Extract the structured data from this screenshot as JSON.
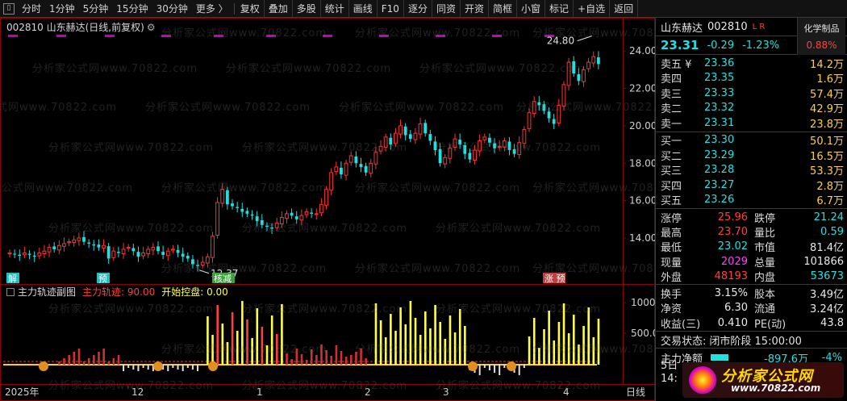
{
  "toolbar": {
    "periods": [
      "分时",
      "1分钟",
      "5分钟",
      "15分钟",
      "30分钟",
      "更多 〉"
    ],
    "buttons": [
      "复权",
      "叠加",
      "多股",
      "统计",
      "画线",
      "F10",
      "逐分",
      "同资",
      "开资",
      "简框",
      "小窗",
      "标记",
      "+自选",
      "返回"
    ]
  },
  "chart": {
    "title": "002810 山东赫达(日线,前复权)",
    "high_label": "24.80",
    "low_label": "12.37",
    "y_ticks": [
      "24.00",
      "22.00",
      "20.00",
      "18.00",
      "16.00",
      "14.00"
    ],
    "x_labels": [
      "2025年",
      "12",
      "1",
      "2",
      "3",
      "4",
      "日线"
    ],
    "event_tags": [
      {
        "text": "解",
        "color": "#20c0c0"
      },
      {
        "text": "预",
        "color": "#20c0c0"
      },
      {
        "text": "核减",
        "color": "#40a040"
      },
      {
        "text": "涨 预",
        "color": "#c04040"
      }
    ],
    "sub_title": {
      "name": "主力轨迹副图",
      "k1": "主力轨迹: 90.00",
      "k2": "开始控盘: 0.00"
    },
    "sub_y_ticks": [
      "1000",
      "500.0"
    ],
    "watermark": "分析家公式网www.70822.com"
  },
  "chart_data": {
    "type": "candlestick",
    "title": "002810 山东赫达(日线,前复权)",
    "y_range": [
      11.8,
      25.0
    ],
    "x_range_labels": [
      "2025年",
      "12",
      "1",
      "2",
      "3",
      "4"
    ],
    "high_marker": 24.8,
    "low_marker": 12.37,
    "closes": [
      13.2,
      13.15,
      13.05,
      13.2,
      13.1,
      13.0,
      13.2,
      13.3,
      13.5,
      13.4,
      13.6,
      13.7,
      13.8,
      13.9,
      14.0,
      13.8,
      13.7,
      13.6,
      13.5,
      13.6,
      12.9,
      13.3,
      13.2,
      13.4,
      13.5,
      13.3,
      13.0,
      13.2,
      13.4,
      13.5,
      13.3,
      13.1,
      13.3,
      13.4,
      13.2,
      13.0,
      12.9,
      12.6,
      12.5,
      12.7,
      13.0,
      14.1,
      15.9,
      16.6,
      15.8,
      15.7,
      15.6,
      15.4,
      15.3,
      15.2,
      14.9,
      14.7,
      14.6,
      14.5,
      14.8,
      15.1,
      15.3,
      15.2,
      15.0,
      15.2,
      15.4,
      15.3,
      15.3,
      15.8,
      16.6,
      17.5,
      17.8,
      17.4,
      18.0,
      18.4,
      18.0,
      17.8,
      17.5,
      18.0,
      18.6,
      18.9,
      19.4,
      19.0,
      19.6,
      20.0,
      19.5,
      19.3,
      19.6,
      20.1,
      19.6,
      19.2,
      18.7,
      18.0,
      18.3,
      18.8,
      19.3,
      19.0,
      18.5,
      18.2,
      18.7,
      19.2,
      19.4,
      19.1,
      18.8,
      18.9,
      19.2,
      18.7,
      18.5,
      19.1,
      19.8,
      20.7,
      21.3,
      21.1,
      20.8,
      20.4,
      20.1,
      21.1,
      22.2,
      23.4,
      22.8,
      22.4,
      23.0,
      23.4,
      23.7,
      23.3
    ],
    "sub_indicator": {
      "name": "主力轨迹副图",
      "series": [
        {
          "name": "主力轨迹",
          "value": 90.0,
          "color": "#ff4040"
        },
        {
          "name": "开始控盘",
          "value": 0.0,
          "color": "#ffff40"
        }
      ],
      "y_ticks": [
        1000,
        500
      ]
    }
  },
  "panel": {
    "name": "山东赫达",
    "code": "002810",
    "lr": "L R",
    "industry_name": "化学制品",
    "industry_pct": "0.88%",
    "price": "23.31",
    "change": "-0.29",
    "change_pct": "-1.23%",
    "asks": [
      {
        "label": "卖五 ¥",
        "price": "23.36",
        "vol": "14.2万"
      },
      {
        "label": "卖四",
        "price": "23.35",
        "vol": "1.6万"
      },
      {
        "label": "卖三",
        "price": "23.33",
        "vol": "57.4万"
      },
      {
        "label": "卖二",
        "price": "23.32",
        "vol": "42.9万"
      },
      {
        "label": "卖一",
        "price": "23.31",
        "vol": "23.8万"
      }
    ],
    "bids": [
      {
        "label": "买一",
        "price": "23.30",
        "vol": "50.1万"
      },
      {
        "label": "买二",
        "price": "23.29",
        "vol": "16.5万"
      },
      {
        "label": "买三",
        "price": "23.28",
        "vol": "53.3万"
      },
      {
        "label": "买四",
        "price": "23.27",
        "vol": "2.8万"
      },
      {
        "label": "买五",
        "price": "23.26",
        "vol": "6.7万"
      }
    ],
    "stats1": [
      {
        "l1": "涨停",
        "v1": "25.96",
        "c1": "c-red",
        "l2": "跌停",
        "v2": "21.24",
        "c2": "c-cyan"
      },
      {
        "l1": "最高",
        "v1": "23.70",
        "c1": "c-red",
        "l2": "量比",
        "v2": "0.59",
        "c2": "c-cyan"
      },
      {
        "l1": "最低",
        "v1": "23.02",
        "c1": "c-cyan",
        "l2": "市值",
        "v2": "81.4亿",
        "c2": "c-white"
      },
      {
        "l1": "现量",
        "v1": "2029",
        "c1": "c-magenta",
        "l2": "总量",
        "v2": "101866",
        "c2": "c-white"
      },
      {
        "l1": "外盘",
        "v1": "48193",
        "c1": "c-red",
        "l2": "内盘",
        "v2": "53673",
        "c2": "c-cyan"
      }
    ],
    "stats2": [
      {
        "l1": "换手",
        "v1": "3.15%",
        "c1": "c-white",
        "l2": "股本",
        "v2": "3.49亿",
        "c2": "c-white"
      },
      {
        "l1": "净资",
        "v1": "6.30",
        "c1": "c-white",
        "l2": "流通",
        "v2": "3.24亿",
        "c2": "c-white"
      },
      {
        "l1": "收益(三)",
        "v1": "0.410",
        "c1": "c-white",
        "l2": "PE(动)",
        "v2": "43.8",
        "c2": "c-white"
      }
    ],
    "trade_state_label": "交易状态:",
    "trade_state_value": "闭市阶段 15:00:00",
    "netflow_label": "主力净额",
    "netflow_value": "-897.6万",
    "netflow_pct": "-4%",
    "day_count": "5日",
    "clock": "14:",
    "logo_text": "分析家公式网",
    "logo_url": "www.70822.com",
    "colors": {
      "up": "#ff3232",
      "down": "#20e0e0",
      "vol": "#ffff40",
      "grid": "#8b0000"
    }
  }
}
